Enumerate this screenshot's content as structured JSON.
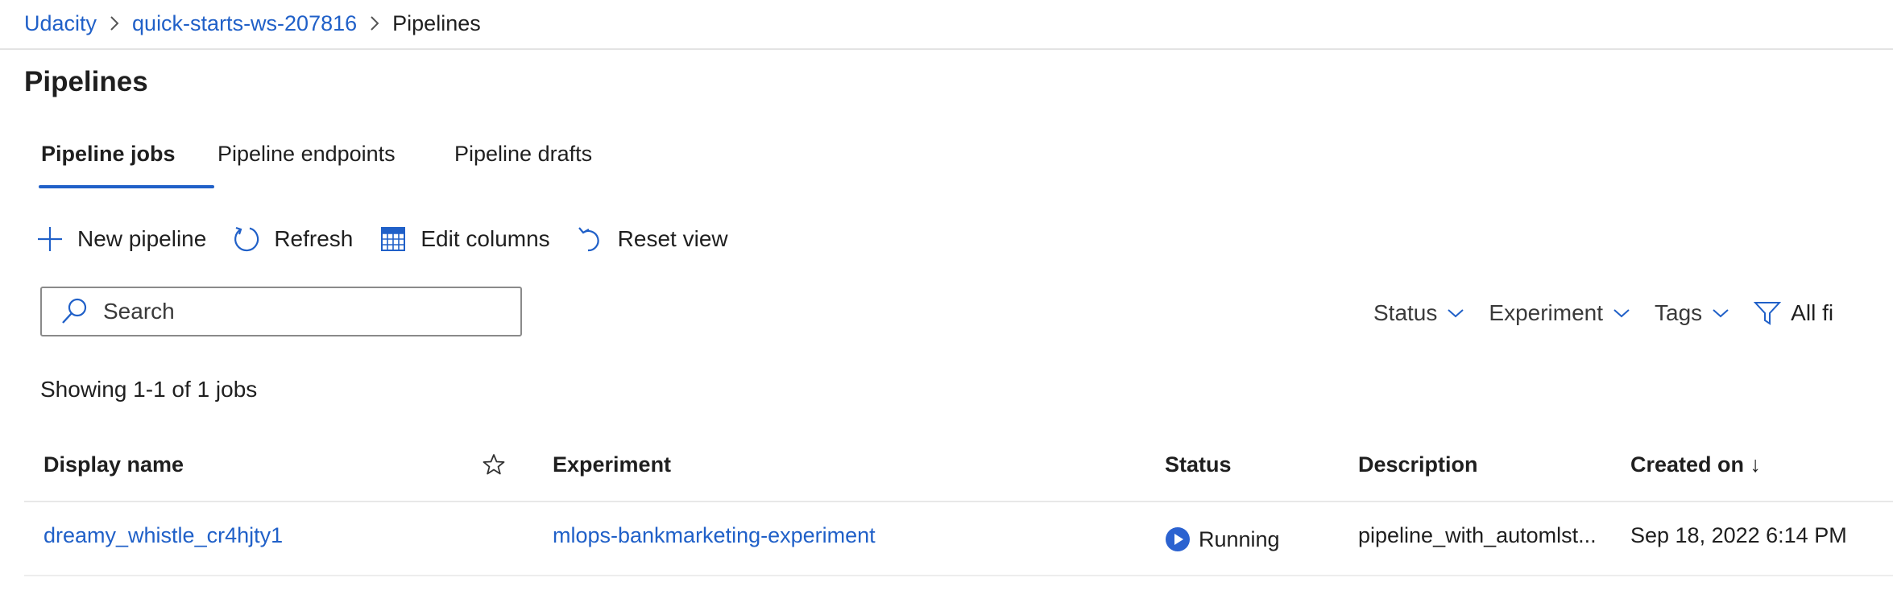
{
  "breadcrumb": {
    "items": [
      "Udacity",
      "quick-starts-ws-207816",
      "Pipelines"
    ]
  },
  "page": {
    "title": "Pipelines"
  },
  "tabs": [
    {
      "label": "Pipeline jobs",
      "active": true
    },
    {
      "label": "Pipeline endpoints",
      "active": false
    },
    {
      "label": "Pipeline drafts",
      "active": false
    }
  ],
  "toolbar": {
    "new_pipeline": "New pipeline",
    "refresh": "Refresh",
    "edit_columns": "Edit columns",
    "reset_view": "Reset view"
  },
  "search": {
    "placeholder": "Search",
    "value": ""
  },
  "filters": {
    "status": "Status",
    "experiment": "Experiment",
    "tags": "Tags",
    "all_filters": "All fi"
  },
  "summary": "Showing 1-1 of 1 jobs",
  "table": {
    "columns": [
      "Display name",
      "Experiment",
      "Status",
      "Description",
      "Created on ↓"
    ],
    "rows": [
      {
        "display_name": "dreamy_whistle_cr4hjty1",
        "experiment": "mlops-bankmarketing-experiment",
        "status": "Running",
        "description": "pipeline_with_automlst...",
        "created_on": "Sep 18, 2022 6:14 PM"
      }
    ]
  },
  "colors": {
    "accent": "#2060c8",
    "text": "#1f1f1f",
    "running": "#2b62d0"
  },
  "icons": {
    "breadcrumb_separator": "chevron-right-icon",
    "new_pipeline": "plus-icon",
    "refresh": "refresh-icon",
    "edit_columns": "table-grid-icon",
    "reset_view": "undo-icon",
    "search": "search-icon",
    "filter_dropdown": "chevron-down-icon",
    "all_filters": "funnel-icon",
    "favorite": "star-icon",
    "status_running": "play-circle-icon"
  }
}
